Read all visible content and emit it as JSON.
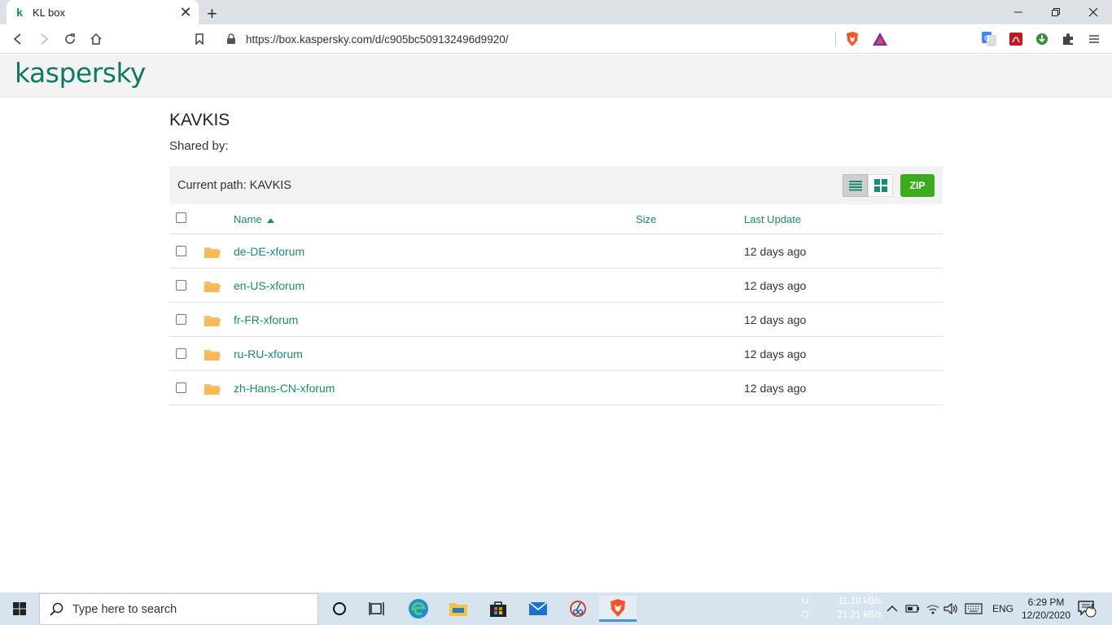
{
  "browser": {
    "tab_title": "KL box",
    "tab_favicon": "k",
    "url": "https://box.kaspersky.com/d/c905bc509132496d9920/"
  },
  "site": {
    "logo_text": "kaspersky",
    "brand_color": "#0d7a62",
    "link_color": "#1a8d6e",
    "zip_color": "#3dab1e"
  },
  "share": {
    "folder_title": "KAVKIS",
    "shared_by": "Shared by:",
    "current_path": "Current path: KAVKIS",
    "zip_label": "ZIP"
  },
  "table": {
    "headers": {
      "name": "Name",
      "size": "Size",
      "last_update": "Last Update"
    },
    "rows": [
      {
        "name": "de-DE-xforum",
        "size": "",
        "last_update": "12 days ago"
      },
      {
        "name": "en-US-xforum",
        "size": "",
        "last_update": "12 days ago"
      },
      {
        "name": "fr-FR-xforum",
        "size": "",
        "last_update": "12 days ago"
      },
      {
        "name": "ru-RU-xforum",
        "size": "",
        "last_update": "12 days ago"
      },
      {
        "name": "zh-Hans-CN-xforum",
        "size": "",
        "last_update": "12 days ago"
      }
    ]
  },
  "taskbar": {
    "search_placeholder": "Type here to search",
    "net_up_label": "U:",
    "net_down_label": "D:",
    "net_up_value": "11.10 kB/s",
    "net_down_value": "21.21 kB/s",
    "language": "ENG",
    "time": "6:29 PM",
    "date": "12/20/2020",
    "notification_count": "4"
  }
}
